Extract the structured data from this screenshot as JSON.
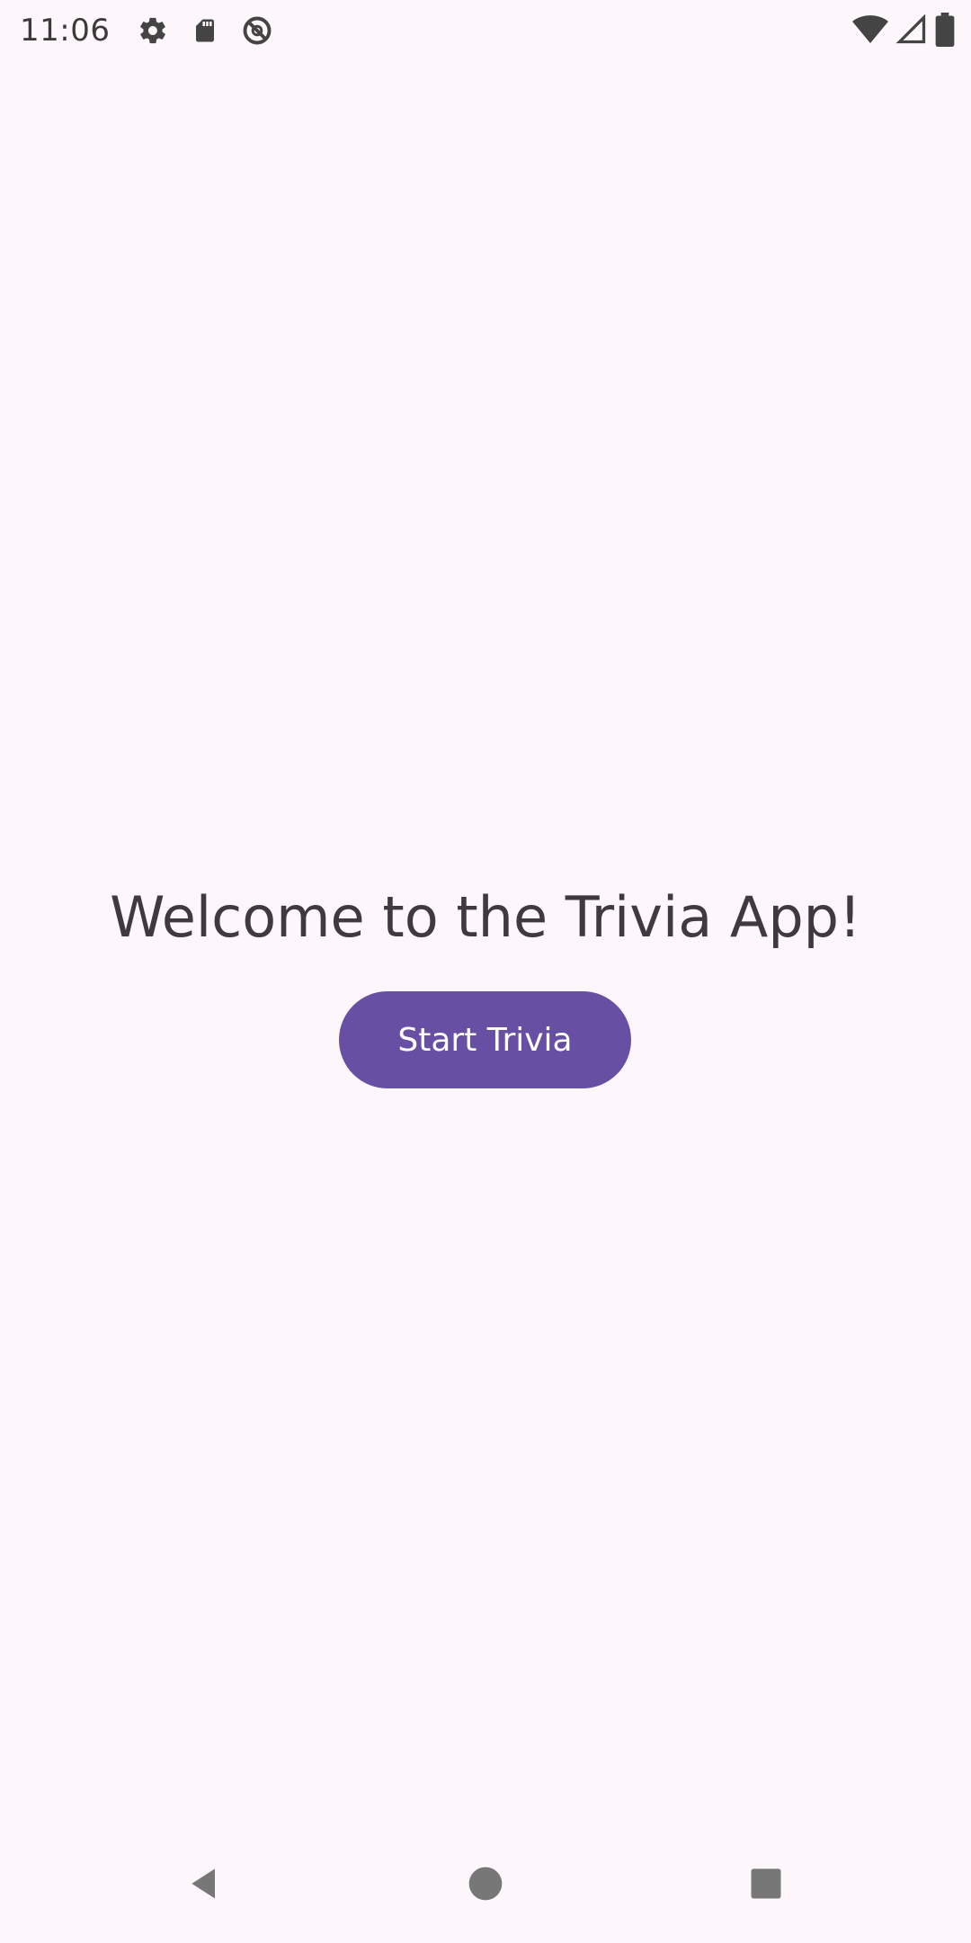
{
  "status_bar": {
    "time": "11:06",
    "left_icons": [
      "gear-icon",
      "sd-card-icon",
      "do-not-disturb-icon"
    ],
    "right_icons": [
      "wifi-icon",
      "cell-signal-icon",
      "battery-icon"
    ]
  },
  "main": {
    "welcome_text": "Welcome to the Trivia App!",
    "start_button_label": "Start Trivia"
  },
  "nav_bar": {
    "buttons": [
      "back-icon",
      "home-icon",
      "recents-icon"
    ]
  },
  "colors": {
    "background": "#fdf7fb",
    "primary": "#6750a4",
    "on_primary": "#ffffff",
    "text": "#3e3a3d"
  }
}
